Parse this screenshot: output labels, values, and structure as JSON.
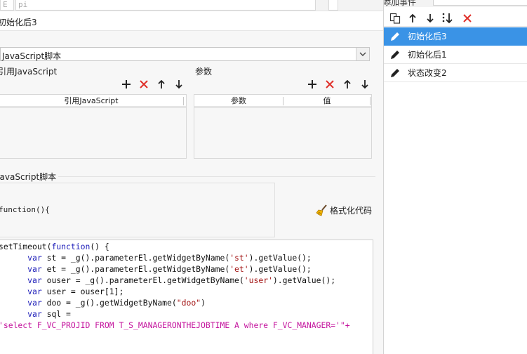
{
  "top_strip": {
    "cell1": "E",
    "cell2": "pi"
  },
  "title": "初始化后3",
  "script_type": {
    "selected": "JavaScript脚本"
  },
  "ref_js": {
    "label": "引用JavaScript",
    "columns": [
      "引用JavaScript"
    ]
  },
  "params": {
    "label": "参数",
    "columns": [
      "参数",
      "值"
    ]
  },
  "js_script": {
    "label": "JavaScript脚本",
    "function_header": "function(){",
    "format_button": "格式化代码"
  },
  "code_lines": [
    [
      {
        "t": "setTimeout(",
        "c": ""
      },
      {
        "t": "function",
        "c": "kw"
      },
      {
        "t": "() {",
        "c": ""
      }
    ],
    [
      {
        "t": "      ",
        "c": ""
      },
      {
        "t": "var",
        "c": "kw"
      },
      {
        "t": " st = _g().parameterEl.getWidgetByName(",
        "c": ""
      },
      {
        "t": "'st'",
        "c": "st"
      },
      {
        "t": ").getValue();",
        "c": ""
      }
    ],
    [
      {
        "t": "      ",
        "c": ""
      },
      {
        "t": "var",
        "c": "kw"
      },
      {
        "t": " et = _g().parameterEl.getWidgetByName(",
        "c": ""
      },
      {
        "t": "'et'",
        "c": "st"
      },
      {
        "t": ").getValue();",
        "c": ""
      }
    ],
    [
      {
        "t": "      ",
        "c": ""
      },
      {
        "t": "var",
        "c": "kw"
      },
      {
        "t": " ouser = _g().parameterEl.getWidgetByName(",
        "c": ""
      },
      {
        "t": "'user'",
        "c": "st"
      },
      {
        "t": ").getValue();",
        "c": ""
      }
    ],
    [
      {
        "t": "      ",
        "c": ""
      },
      {
        "t": "var",
        "c": "kw"
      },
      {
        "t": " user = ouser[1];",
        "c": ""
      }
    ],
    [
      {
        "t": "      ",
        "c": ""
      },
      {
        "t": "var",
        "c": "kw"
      },
      {
        "t": " doo = _g().getWidgetByName(",
        "c": ""
      },
      {
        "t": "\"doo\"",
        "c": "st"
      },
      {
        "t": ")",
        "c": ""
      }
    ],
    [
      {
        "t": "      ",
        "c": ""
      },
      {
        "t": "var",
        "c": "kw"
      },
      {
        "t": " sql =",
        "c": ""
      }
    ],
    [
      {
        "t": "'select F_VC_PROJID FROM T_S_MANAGERONTHEJOBTIME A where F_VC_MANAGER='\"+",
        "c": "sq"
      }
    ]
  ],
  "events_panel": {
    "header": "添加事件",
    "items": [
      {
        "label": "初始化后3",
        "selected": true
      },
      {
        "label": "初始化后1",
        "selected": false
      },
      {
        "label": "状态改变2",
        "selected": false
      }
    ]
  },
  "colors": {
    "selection": "#3a93e6",
    "delete_red": "#e0302a"
  }
}
